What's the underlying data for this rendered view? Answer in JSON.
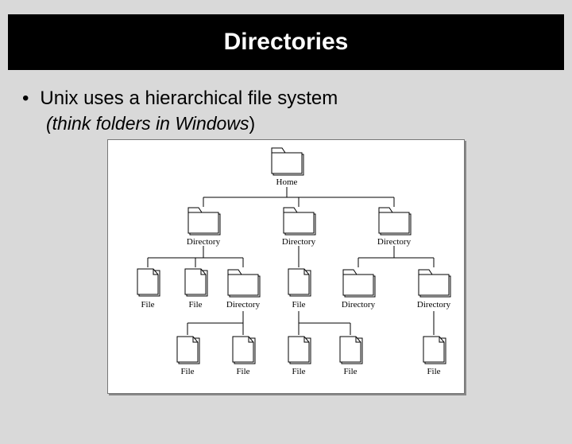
{
  "slide": {
    "title": "Directories",
    "bullet": "Unix uses a hierarchical file system",
    "hint_open": "(",
    "hint_italic": "think folders in Windows",
    "hint_close": ")"
  },
  "diagram": {
    "root": "Home",
    "nodes": {
      "directory": "Directory",
      "file": "File"
    }
  }
}
